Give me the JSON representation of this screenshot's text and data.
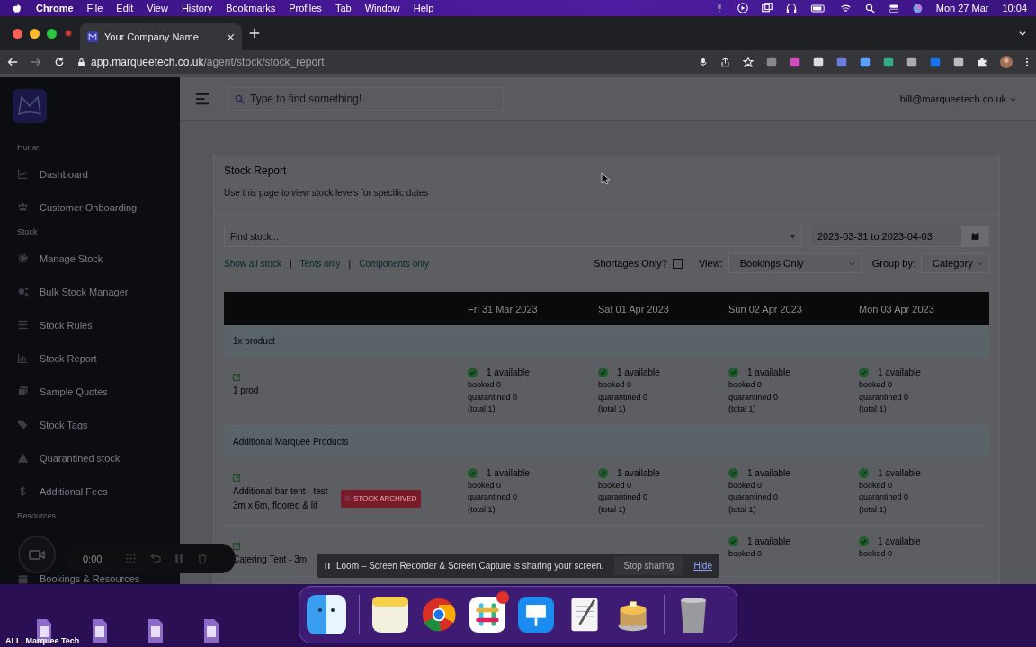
{
  "menu_bar": {
    "app": "Chrome",
    "menus": [
      "File",
      "Edit",
      "View",
      "History",
      "Bookmarks",
      "Profiles",
      "Tab",
      "Window",
      "Help"
    ],
    "date": "Mon 27 Mar",
    "time": "10:04"
  },
  "browser": {
    "tab_title": "Your Company Name",
    "url_host": "app.marqueetech.co.uk",
    "url_path": "/agent/stock/stock_report"
  },
  "sidebar": {
    "sections": [
      {
        "label": "Home",
        "items": [
          "Dashboard",
          "Customer Onboarding"
        ]
      },
      {
        "label": "Stock",
        "items": [
          "Manage Stock",
          "Bulk Stock Manager",
          "Stock Rules",
          "Stock Report",
          "Sample Quotes",
          "Stock Tags",
          "Quarantined stock",
          "Additional Fees"
        ]
      },
      {
        "label": "Resources",
        "items": [
          "Bookings & Resources"
        ]
      }
    ]
  },
  "topbar": {
    "search": {
      "placeholder": "Type to find something!"
    },
    "user": "bill@marqueetech.co.uk"
  },
  "report": {
    "title": "Stock Report",
    "subtitle": "Use this page to view stock levels for specific dates",
    "find_stock": {
      "placeholder": "Find stock..."
    },
    "date_range": "2023-03-31 to 2023-04-03",
    "filters": [
      "Show all stock",
      "Tents only",
      "Components only"
    ],
    "filter_separators": [
      "|",
      "|"
    ],
    "shortages": {
      "label": "Shortages Only?",
      "checked": false
    },
    "view": {
      "label": "View:",
      "value": "Bookings Only"
    },
    "group_by": {
      "label": "Group by:",
      "value": "Category"
    }
  },
  "table": {
    "columns": [
      "Fri 31 Mar 2023",
      "Sat 01 Apr 2023",
      "Sun 02 Apr 2023",
      "Mon 03 Apr 2023"
    ],
    "groups": [
      {
        "name": "1x product",
        "rows": [
          {
            "name": "1 prod",
            "cells": [
              {
                "available": "1 available",
                "booked": "booked 0",
                "quarantined": "quarantined 0",
                "total": "(total 1)"
              },
              {
                "available": "1 available",
                "booked": "booked 0",
                "quarantined": "quarantined 0",
                "total": "(total 1)"
              },
              {
                "available": "1 available",
                "booked": "booked 0",
                "quarantined": "quarantined 0",
                "total": "(total 1)"
              },
              {
                "available": "1 available",
                "booked": "booked 0",
                "quarantined": "quarantined 0",
                "total": "(total 1)"
              }
            ]
          }
        ]
      },
      {
        "name": "Additional Marquee Products",
        "rows": [
          {
            "name": "Additional bar tent - test 3m x 6m, floored & lit",
            "badge": "STOCK ARCHIVED",
            "cells": [
              {
                "available": "1 available",
                "booked": "booked 0",
                "quarantined": "quarantined 0",
                "total": "(total 1)"
              },
              {
                "available": "1 available",
                "booked": "booked 0",
                "quarantined": "quarantined 0",
                "total": "(total 1)"
              },
              {
                "available": "1 available",
                "booked": "booked 0",
                "quarantined": "quarantined 0",
                "total": "(total 1)"
              },
              {
                "available": "1 available",
                "booked": "booked 0",
                "quarantined": "quarantined 0",
                "total": "(total 1)"
              }
            ]
          },
          {
            "name": "Catering Tent - 3m",
            "cells": [
              null,
              null,
              {
                "available": "1 available",
                "booked": "booked 0"
              },
              {
                "available": "1 available",
                "booked": "booked 0"
              }
            ]
          }
        ]
      }
    ]
  },
  "recorder": {
    "timer": "0:00"
  },
  "share_banner": {
    "message": "Loom – Screen Recorder & Screen Capture is sharing your screen.",
    "stop": "Stop sharing",
    "hide": "Hide"
  },
  "desktop": {
    "file_label": "ALL. Marquee Tech"
  }
}
